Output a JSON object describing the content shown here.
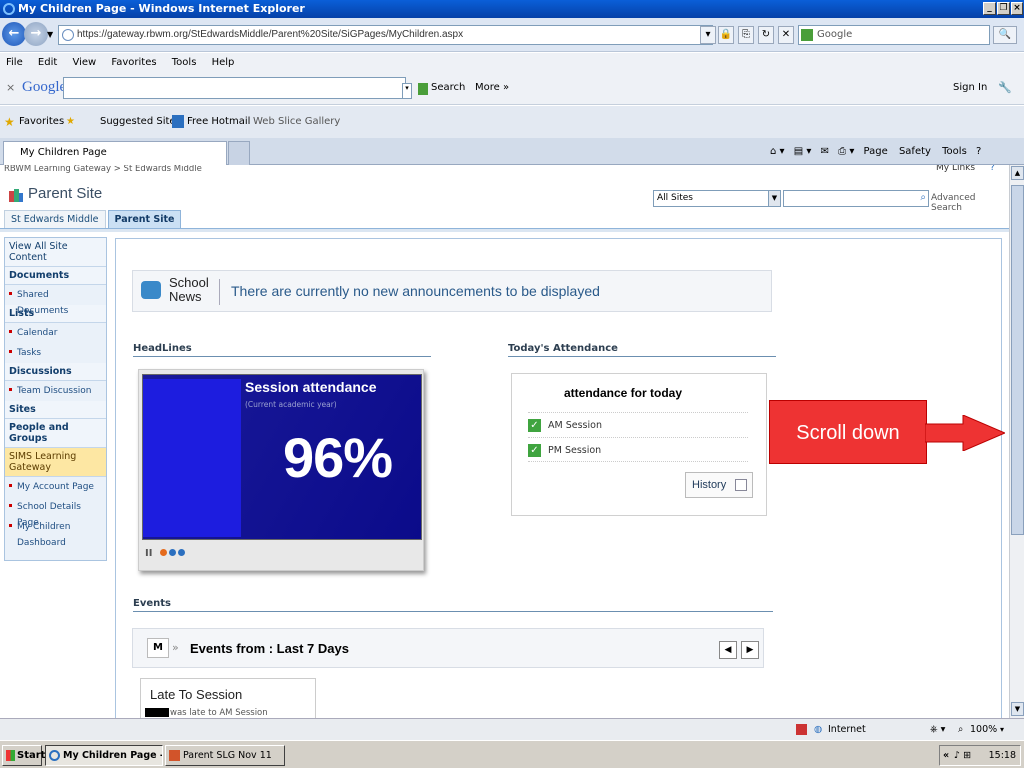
{
  "window": {
    "title": "My Children Page - Windows Internet Explorer"
  },
  "address": {
    "url": "https://gateway.rbwm.org/StEdwardsMiddle/Parent%20Site/SiGPages/MyChildren.aspx"
  },
  "search_box": {
    "placeholder": "Google"
  },
  "menu": [
    "File",
    "Edit",
    "View",
    "Favorites",
    "Tools",
    "Help"
  ],
  "google_toolbar": {
    "logo": "Google",
    "search_label": "Search",
    "more_label": "More »",
    "signin": "Sign In"
  },
  "favorites_bar": {
    "favorites": "Favorites",
    "suggested": "Suggested Sites",
    "hotmail": "Free Hotmail",
    "gallery": "Web Slice Gallery"
  },
  "tab": {
    "title": "My Children Page"
  },
  "command_bar": {
    "page": "Page",
    "safety": "Safety",
    "tools": "Tools"
  },
  "site": {
    "breadcrumb": "RBWM Learning Gateway > St Edwards Middle",
    "my_links": "My Links",
    "title": "Parent Site",
    "nav_tabs": [
      "St Edwards Middle",
      "Parent Site"
    ],
    "scope": "All Sites",
    "advanced_search": "Advanced Search"
  },
  "quick_launch": {
    "view_all": "View All Site Content",
    "documents": "Documents",
    "shared_documents": "Shared Documents",
    "lists": "Lists",
    "calendar": "Calendar",
    "tasks": "Tasks",
    "discussions": "Discussions",
    "team_discussion": "Team Discussion",
    "sites": "Sites",
    "people_groups": "People and Groups",
    "sims": "SIMS Learning Gateway",
    "my_account": "My Account Page",
    "school_details": "School Details Page",
    "my_children": "My Children Dashboard"
  },
  "news": {
    "label_line1": "School",
    "label_line2": "News",
    "message": "There are currently no new announcements to be displayed"
  },
  "headlines": {
    "heading": "HeadLines",
    "title": "Session attendance",
    "subtitle": "(Current academic year)",
    "percentage": "96%",
    "pause": "II"
  },
  "attendance": {
    "heading": "Today's Attendance",
    "title": "attendance for today",
    "rows": [
      "AM Session",
      "PM Session"
    ],
    "history": "History"
  },
  "events": {
    "heading": "Events",
    "title": "Events from : Last 7 Days",
    "card_title": "Late To Session",
    "card_desc": "was late to AM Session"
  },
  "callout": {
    "text": "Scroll down"
  },
  "status": {
    "zone": "Internet",
    "zoom": "100%"
  },
  "taskbar": {
    "start": "Start",
    "tasks": [
      "My Children Page - Wi...",
      "Parent SLG Nov 11"
    ],
    "clock": "15:18"
  },
  "colors": {
    "callout": "#ee3333",
    "accent": "#1a1a9a"
  }
}
